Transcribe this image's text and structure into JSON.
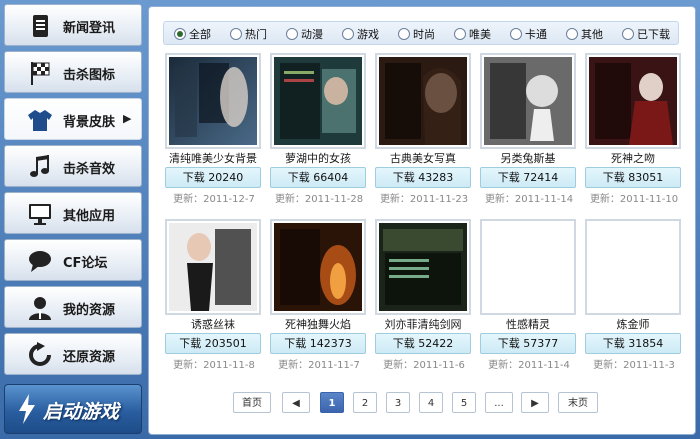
{
  "sidebar": {
    "items": [
      {
        "label": "新闻登讯",
        "icon": "document-icon"
      },
      {
        "label": "击杀图标",
        "icon": "checkered-flag-icon"
      },
      {
        "label": "背景皮肤",
        "icon": "tshirt-icon"
      },
      {
        "label": "击杀音效",
        "icon": "music-note-icon"
      },
      {
        "label": "其他应用",
        "icon": "monitor-icon"
      },
      {
        "label": "CF论坛",
        "icon": "chat-bubble-icon"
      },
      {
        "label": "我的资源",
        "icon": "user-icon"
      },
      {
        "label": "还原资源",
        "icon": "refresh-icon"
      }
    ],
    "active_index": 2,
    "start_button": "启动游戏"
  },
  "filters": [
    "全部",
    "热门",
    "动漫",
    "游戏",
    "时尚",
    "唯美",
    "卡通",
    "其他",
    "已下载"
  ],
  "selected_filter": "全部",
  "skins": [
    {
      "title": "清纯唯美少女背景",
      "download": "下载 20240",
      "updated": "更新：2011-12-7",
      "thumb": "dark-blue"
    },
    {
      "title": "萝湖中的女孩",
      "download": "下载 66404",
      "updated": "更新：2011-11-28",
      "thumb": "teal"
    },
    {
      "title": "古典美女写真",
      "download": "下载 43283",
      "updated": "更新：2011-11-23",
      "thumb": "sepia"
    },
    {
      "title": "另类兔斯基",
      "download": "下载 72414",
      "updated": "更新：2011-11-14",
      "thumb": "grey"
    },
    {
      "title": "死神之吻",
      "download": "下载 83051",
      "updated": "更新：2011-11-10",
      "thumb": "red"
    },
    {
      "title": "诱惑丝袜",
      "download": "下载 203501",
      "updated": "更新：2011-11-8",
      "thumb": "light"
    },
    {
      "title": "死神独舞火焰",
      "download": "下载 142373",
      "updated": "更新：2011-11-7",
      "thumb": "fire"
    },
    {
      "title": "刘亦菲清纯剑网",
      "download": "下载 52422",
      "updated": "更新：2011-11-6",
      "thumb": "green"
    },
    {
      "title": "性感精灵",
      "download": "下载 57377",
      "updated": "更新：2011-11-4",
      "thumb": "blank"
    },
    {
      "title": "炼金师",
      "download": "下载 31854",
      "updated": "更新：2011-11-3",
      "thumb": "blank"
    }
  ],
  "pagination": {
    "first": "首页",
    "prev": "◀",
    "pages": [
      "1",
      "2",
      "3",
      "4",
      "5",
      "..."
    ],
    "current": "1",
    "next": "▶",
    "last": "末页"
  }
}
